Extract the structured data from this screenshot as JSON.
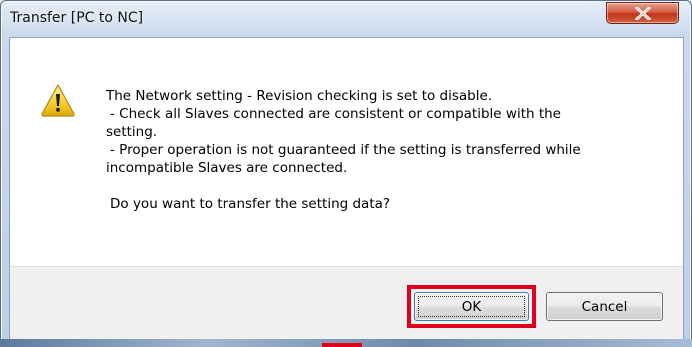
{
  "window": {
    "title": "Transfer [PC to NC]",
    "close_icon": "close-icon"
  },
  "message": {
    "icon": "warning-icon",
    "lines": [
      "The Network setting - Revision checking is set to disable.",
      " - Check all Slaves connected are consistent or compatible with the",
      "setting.",
      " - Proper operation is not guaranteed if the setting is transferred while",
      "incompatible Slaves are connected."
    ],
    "question": "Do you want to transfer the setting data?"
  },
  "buttons": {
    "ok_label": "OK",
    "cancel_label": "Cancel"
  },
  "colors": {
    "highlight": "#e0001b",
    "close_button": "#c0341a"
  }
}
